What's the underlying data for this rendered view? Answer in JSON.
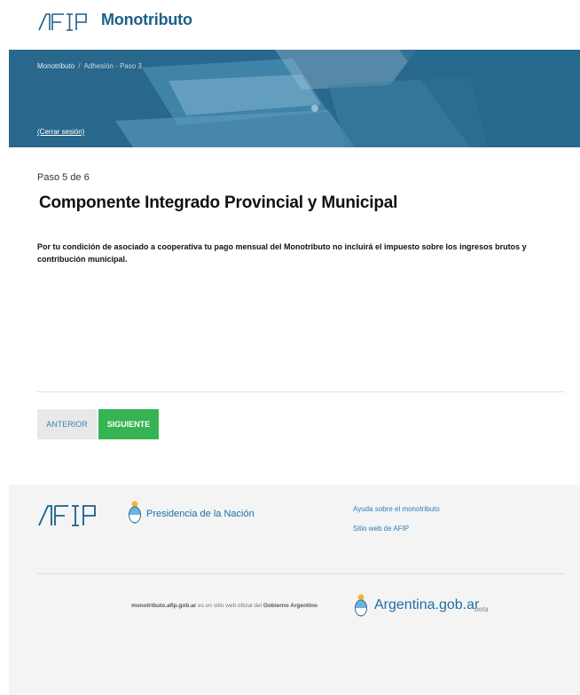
{
  "header": {
    "brand": "Monotributo"
  },
  "hero": {
    "breadcrumb": [
      "Monotributo",
      "Adhesión - Paso 3"
    ],
    "separator": "/",
    "logout": "(Cerrar sesión)"
  },
  "content": {
    "step": "Paso 5 de 6",
    "title": "Componente Integrado Provincial y Municipal",
    "description": "Por tu condición de asociado a cooperativa tu pago mensual del Monotributo no incluirá el impuesto sobre los ingresos brutos y contribución municipal."
  },
  "buttons": {
    "prev": "ANTERIOR",
    "next": "SIGUIENTE"
  },
  "footer": {
    "presidencia": "Presidencia de la Nación",
    "links": [
      "Ayuda sobre el monotributo",
      "Sitio web de AFIP"
    ],
    "legal_site": "monotributo.afip.gob.ar",
    "legal_text": "es un sitio web oficial del",
    "legal_gov": "Gobierno Argentino",
    "argentina": "Argentina.gob.ar",
    "beta": "beta"
  },
  "colors": {
    "brand_blue": "#1b5f8c",
    "hero_bg": "#2e6f92",
    "next_green": "#36b453",
    "link_blue": "#2d7fba"
  },
  "icons": [
    "afip-logo",
    "escudo-icon"
  ]
}
